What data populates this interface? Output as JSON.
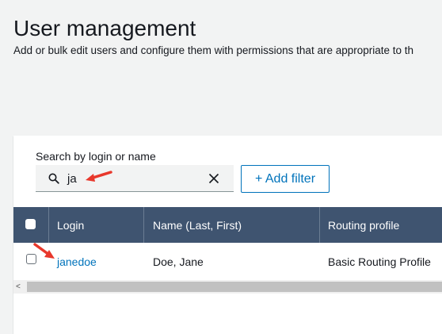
{
  "page": {
    "title": "User management",
    "subtitle": "Add or bulk edit users and configure them with permissions that are appropriate to th"
  },
  "search": {
    "label": "Search by login or name",
    "value": "ja",
    "icon": "search-icon",
    "clear_icon": "close-icon"
  },
  "toolbar": {
    "add_filter_label": "+ Add filter"
  },
  "table": {
    "columns": [
      "Login",
      "Name (Last, First)",
      "Routing profile"
    ],
    "rows": [
      {
        "login": "janedoe",
        "name": "Doe, Jane",
        "routing_profile": "Basic Routing Profile"
      }
    ]
  },
  "scrollbar": {
    "left_arrow": "<"
  },
  "colors": {
    "header_bg": "#3f5470",
    "link": "#0073bb",
    "annotation_arrow": "#e8382c"
  }
}
